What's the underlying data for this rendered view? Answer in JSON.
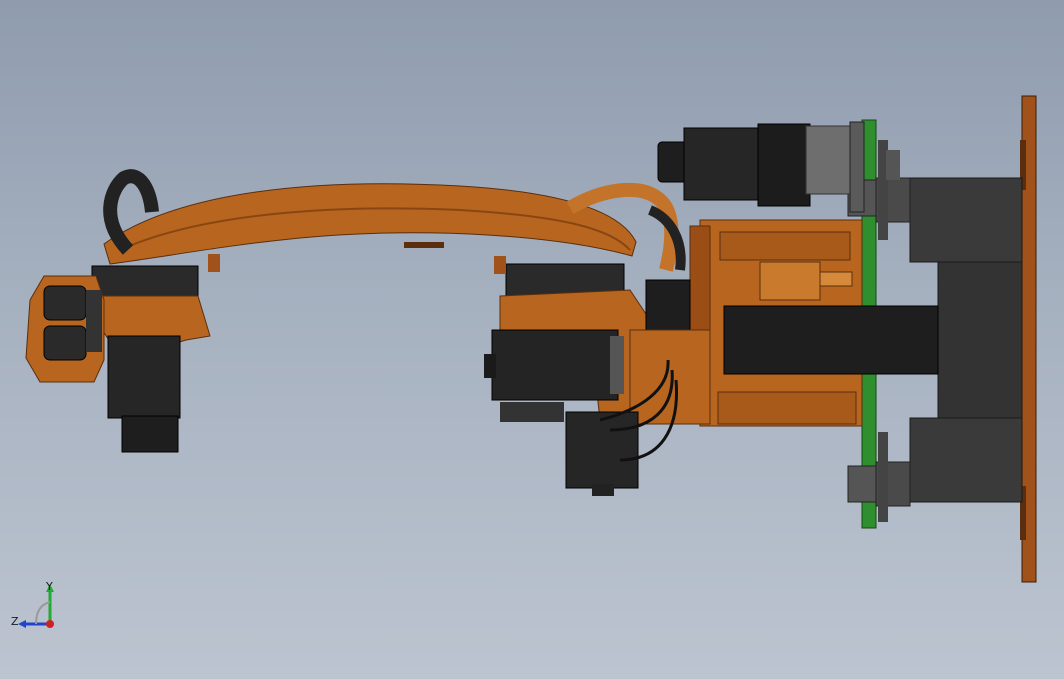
{
  "viewport": {
    "background_top": "#8f9cae",
    "background_bottom": "#bcc4d0"
  },
  "model": {
    "description_colors": {
      "arm": "#b8651f",
      "arm_dark": "#7a3e10",
      "motor": "#2a2a2a",
      "plate": "#2f8f2f",
      "base": "#3a3a3a",
      "flange": "#a0521a"
    }
  },
  "triad": {
    "y_label": "Y",
    "z_label": "Z",
    "y_color": "#22aa33",
    "z_color": "#2244cc",
    "origin_color": "#cc2222"
  }
}
